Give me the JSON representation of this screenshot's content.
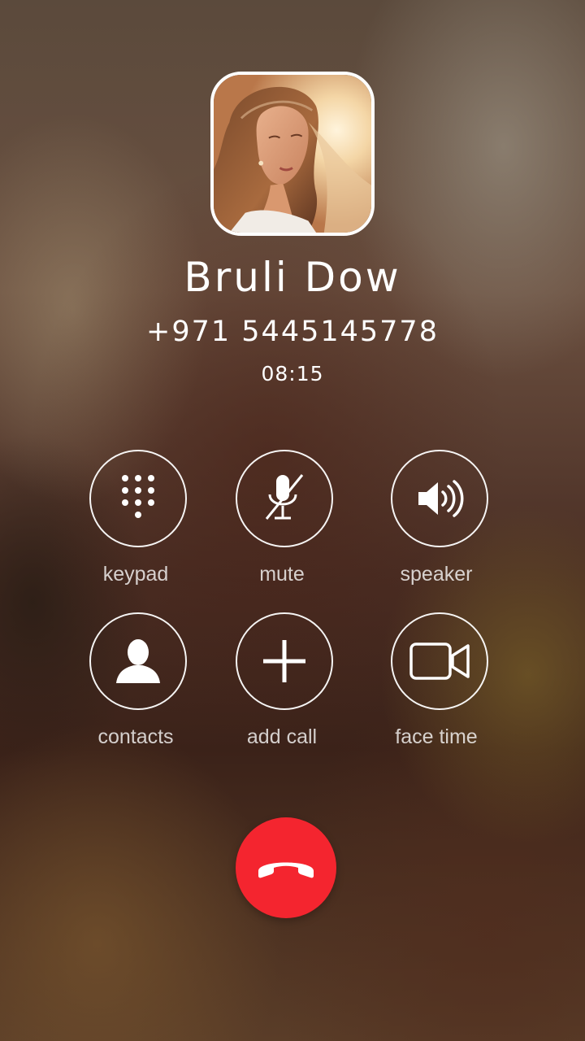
{
  "caller": {
    "name": "Bruli Dow",
    "number": "+971 5445145778",
    "timer": "08:15"
  },
  "controls": [
    {
      "id": "keypad",
      "label": "keypad",
      "icon": "keypad-icon"
    },
    {
      "id": "mute",
      "label": "mute",
      "icon": "mute-microphone-icon"
    },
    {
      "id": "speaker",
      "label": "speaker",
      "icon": "speaker-icon"
    },
    {
      "id": "contacts",
      "label": "contacts",
      "icon": "contact-person-icon"
    },
    {
      "id": "add-call",
      "label": "add call",
      "icon": "plus-icon"
    },
    {
      "id": "face-time",
      "label": "face time",
      "icon": "video-camera-icon"
    }
  ],
  "end_call": {
    "icon": "end-call-phone-icon"
  },
  "colors": {
    "end_call": "#f4252f",
    "text": "#ffffff"
  }
}
